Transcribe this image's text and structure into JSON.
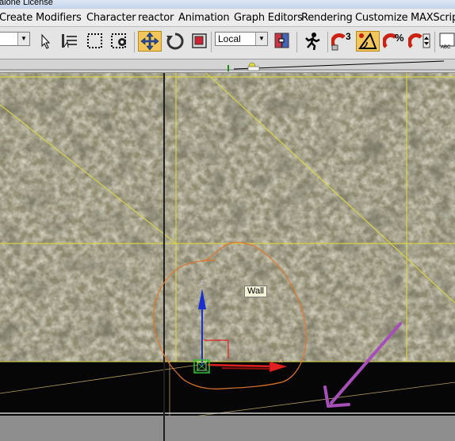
{
  "window": {
    "title": "alone License"
  },
  "menu": {
    "items": [
      {
        "id": "create",
        "label": "Create"
      },
      {
        "id": "modifiers",
        "label": "Modifiers"
      },
      {
        "id": "character",
        "label": "Character"
      },
      {
        "id": "reactor",
        "label": "reactor"
      },
      {
        "id": "animation",
        "label": "Animation"
      },
      {
        "id": "graph-editors",
        "label": "Graph Editors"
      },
      {
        "id": "rendering",
        "label": "Rendering"
      },
      {
        "id": "customize",
        "label": "Customize"
      },
      {
        "id": "maxscript",
        "label": "MAXScript"
      }
    ]
  },
  "toolbar": {
    "selection_filter": "",
    "coordinate_system": "Local",
    "snap_angle_superscript": "3",
    "percent_snap_label": "%",
    "active_tool": "select-and-move",
    "icons": [
      "select-object-icon",
      "select-by-name-icon",
      "rectangular-selection-icon",
      "window-crossing-icon",
      "select-and-move-icon",
      "select-and-rotate-icon",
      "select-and-scale-icon",
      "use-pivot-center-icon",
      "select-and-manipulate-icon",
      "snaps-toggle-icon",
      "angle-snap-icon",
      "percent-snap-icon",
      "spinner-snap-icon"
    ]
  },
  "viewport": {
    "object_label": "Wall",
    "gizmo": {
      "z_label": "z",
      "x_label": "x"
    },
    "annotation_arrow_color": "#a64fb8",
    "grid_color": "#d8d84a",
    "selection_outline_color": "#e2762a",
    "floor_color": "#060606"
  }
}
